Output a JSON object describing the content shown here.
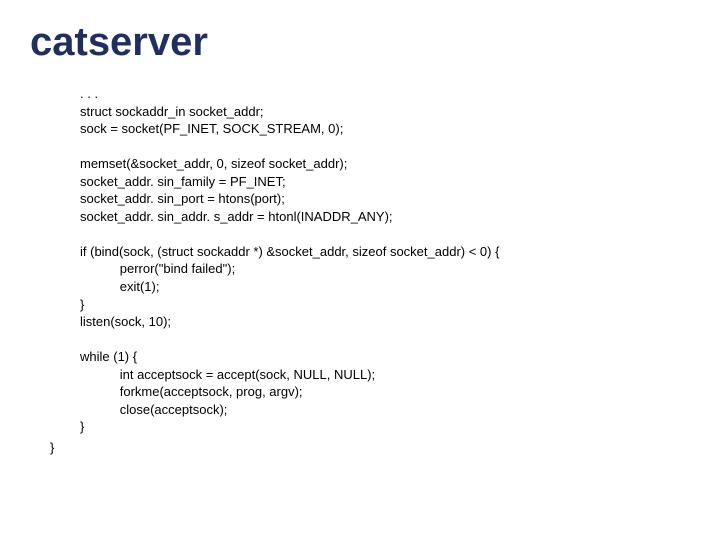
{
  "title": "catserver",
  "code": ". . .\nstruct sockaddr_in socket_addr;\nsock = socket(PF_INET, SOCK_STREAM, 0);\n\nmemset(&socket_addr, 0, sizeof socket_addr);\nsocket_addr. sin_family = PF_INET;\nsocket_addr. sin_port = htons(port);\nsocket_addr. sin_addr. s_addr = htonl(INADDR_ANY);\n\nif (bind(sock, (struct sockaddr *) &socket_addr, sizeof socket_addr) < 0) {\n           perror(\"bind failed\");\n           exit(1);\n}\nlisten(sock, 10);\n\nwhile (1) {\n           int acceptsock = accept(sock, NULL, NULL);\n           forkme(acceptsock, prog, argv);\n           close(acceptsock);\n}",
  "closing": "}"
}
